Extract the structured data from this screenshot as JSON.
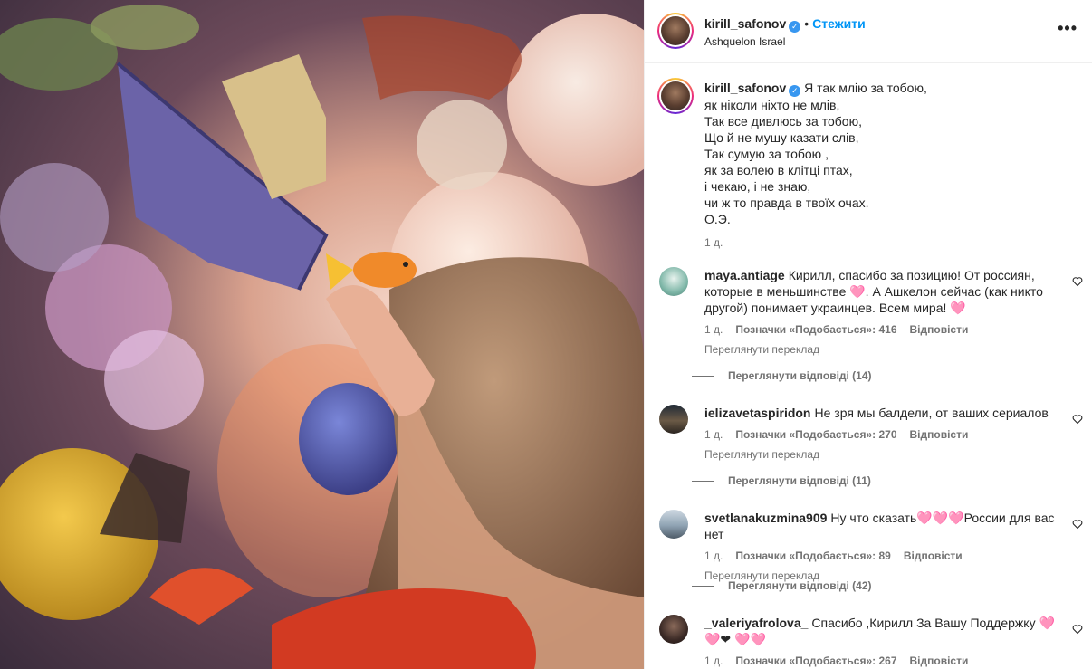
{
  "post": {
    "username": "kirill_safonov",
    "follow_label": "Стежити",
    "location": "Ashquelon Israel",
    "more_label": "•••",
    "verified_mark": "✓"
  },
  "caption": {
    "lines": [
      "Я так млію за тобою,",
      "як ніколи ніхто не млів,",
      "Так все дивлюсь за тобою,",
      "Що й не мушу казати слів,",
      "Так сумую за тобою ,",
      "як за волею в клітці птах,",
      "і чекаю, і не знаю,",
      "чи ж то правда в твоїх очах.",
      "О.Э."
    ],
    "time": "1 д."
  },
  "comments": [
    {
      "username": "maya.antiage",
      "text": "Кирилл, спасибо за позицию! От россиян, которые в меньшинстве 🩷. А Ашкелон сейчас (как никто другой) понимает украинцев. Всем мира! 🩷",
      "time": "1 д.",
      "likes": "Позначки «Подобається»: 416",
      "reply": "Відповісти",
      "translate": "Переглянути переклад",
      "replies": "Переглянути відповіді (14)",
      "avatar_color": "#7fb7a8"
    },
    {
      "username": "ielizavetaspiridon",
      "text": "Не зря мы балдели, от ваших сериалов",
      "time": "1 д.",
      "likes": "Позначки «Подобається»: 270",
      "reply": "Відповісти",
      "translate": "Переглянути переклад",
      "replies": "Переглянути відповіді (11)",
      "avatar_color": "#2e2a24"
    },
    {
      "username": "svetlanakuzmina909",
      "text": "Ну что сказать🩷🩷🩷России для вас нет",
      "time": "1 д.",
      "likes": "Позначки «Подобається»: 89",
      "reply": "Відповісти",
      "translate": "Переглянути переклад",
      "replies": "Переглянути відповіді (42)",
      "avatar_color": "#8fa3b3"
    },
    {
      "username": "_valeriyafrolova_",
      "text": "Спасибо ,Кирилл За Вашу Поддержку 🩷🩷❤ 🩷🩷",
      "time": "1 д.",
      "likes": "Позначки «Подобається»: 267",
      "reply": "Відповісти",
      "avatar_color": "#3b2a26"
    }
  ]
}
